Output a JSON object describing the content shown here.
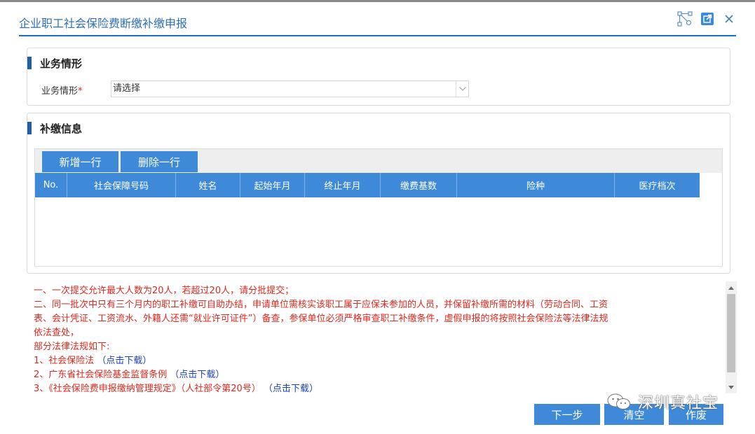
{
  "window": {
    "title": "企业职工社会保险费断缴补缴申报",
    "controls": [
      "diagram-icon",
      "popout-icon",
      "close-icon"
    ]
  },
  "business_section": {
    "heading": "业务情形",
    "field_label": "业务情形",
    "required_mark": "*",
    "select_value": "请选择"
  },
  "supplement_section": {
    "heading": "补缴信息",
    "add_row_label": "新增一行",
    "delete_row_label": "删除一行",
    "columns": [
      "No.",
      "社会保障号码",
      "姓名",
      "起始年月",
      "终止年月",
      "缴费基数",
      "险种",
      "医疗档次"
    ],
    "rows": []
  },
  "notes": {
    "line1": "一、一次提交允许最大人数为20人，若超过20人，请分批提交；",
    "line2": "二、同一批次中只有三个月内的职工补缴可自助办结，申请单位需核实该职工属于应保未参加的人员，并保留补缴所需的材料（劳动合同、工资",
    "line3": "表、会计凭证、工资流水、外籍人还需“就业许可证件”）备查，参保单位必须严格审查职工补缴条件，虚假申报的将按照社会保险法等法律法规",
    "line4": "依法查处，",
    "line5": "部分法律法规如下:",
    "law1_text": "1、社会保险法",
    "law1_link": "（点击下载）",
    "law2_text": "2、广东省社会保险基金监督条例",
    "law2_link": "（点击下载）",
    "law3_text": "3、《社会保险费申报缴纳管理规定》（人社部令第20号）",
    "law3_link": "（点击下载）"
  },
  "actions": {
    "next_label": "下一步",
    "clear_label": "清空",
    "void_label": "作废"
  },
  "watermark": {
    "text": "深圳真社宝"
  },
  "colors": {
    "accent": "#3e8ad8",
    "title": "#2f6fb0",
    "warning_text": "#e0281e",
    "link": "#1a3fc7"
  }
}
